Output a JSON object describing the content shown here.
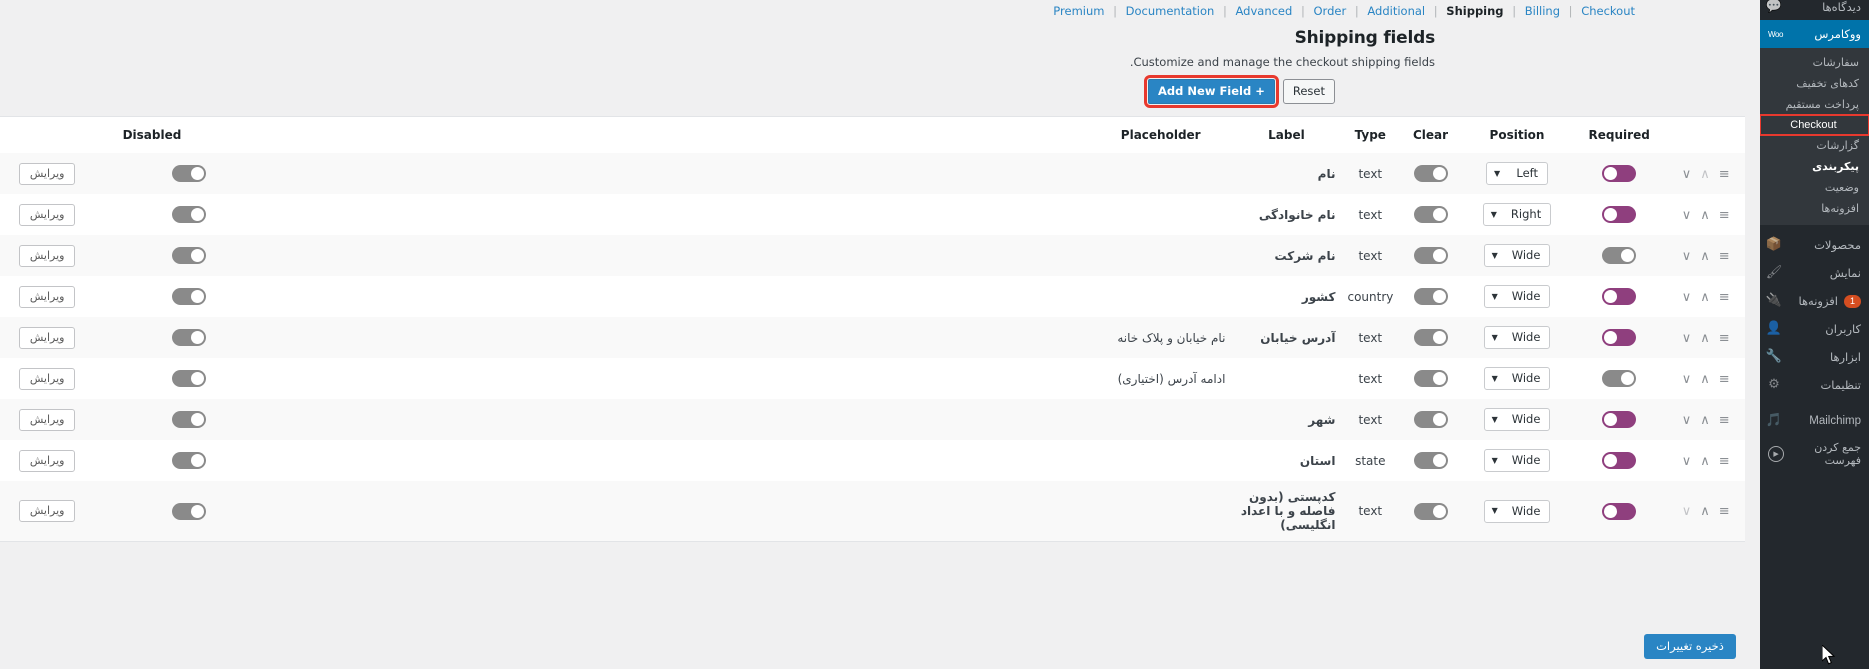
{
  "topnav": {
    "items": [
      {
        "label": "Premium",
        "active": false
      },
      {
        "label": "Documentation",
        "active": false
      },
      {
        "label": "Advanced",
        "active": false
      },
      {
        "label": "Order",
        "active": false
      },
      {
        "label": "Additional",
        "active": false
      },
      {
        "label": "Shipping",
        "active": true
      },
      {
        "label": "Billing",
        "active": false
      },
      {
        "label": "Checkout",
        "active": false
      }
    ],
    "divider": "|"
  },
  "page": {
    "title": "Shipping fields",
    "description": ".Customize and manage the checkout shipping fields",
    "reset_label": "Reset",
    "add_new_label": "Add New Field +",
    "save_label": "ذخیره تغییرات",
    "accent": "#2a85c4",
    "highlight": "#e8392e"
  },
  "table": {
    "headers": {
      "disabled": "Disabled",
      "placeholder": "Placeholder",
      "label": "Label",
      "type": "Type",
      "clear": "Clear",
      "position": "Position",
      "required": "Required"
    },
    "edit_label": "ویرایش",
    "rows": [
      {
        "edit": "ویرایش",
        "disabled": "off",
        "placeholder": "",
        "label": "نام",
        "type": "text",
        "clear": "off",
        "position": "Left",
        "required": "on",
        "sort_down": true,
        "sort_up": false
      },
      {
        "edit": "ویرایش",
        "disabled": "off",
        "placeholder": "",
        "label": "نام خانوادگی",
        "type": "text",
        "clear": "off",
        "position": "Right",
        "required": "on",
        "sort_down": true,
        "sort_up": true
      },
      {
        "edit": "ویرایش",
        "disabled": "off",
        "placeholder": "",
        "label": "نام شرکت",
        "type": "text",
        "clear": "off",
        "position": "Wide",
        "required": "off",
        "sort_down": true,
        "sort_up": true
      },
      {
        "edit": "ویرایش",
        "disabled": "off",
        "placeholder": "",
        "label": "کشور",
        "type": "country",
        "clear": "off",
        "position": "Wide",
        "required": "on",
        "sort_down": true,
        "sort_up": true
      },
      {
        "edit": "ویرایش",
        "disabled": "off",
        "placeholder": "نام خیابان و پلاک خانه",
        "label": "آدرس خیابان",
        "type": "text",
        "clear": "off",
        "position": "Wide",
        "required": "on",
        "sort_down": true,
        "sort_up": true
      },
      {
        "edit": "ویرایش",
        "disabled": "off",
        "placeholder": "ادامه آدرس (اختیاری)",
        "label": "",
        "type": "text",
        "clear": "off",
        "position": "Wide",
        "required": "off",
        "sort_down": true,
        "sort_up": true
      },
      {
        "edit": "ویرایش",
        "disabled": "off",
        "placeholder": "",
        "label": "شهر",
        "type": "text",
        "clear": "off",
        "position": "Wide",
        "required": "on",
        "sort_down": true,
        "sort_up": true
      },
      {
        "edit": "ویرایش",
        "disabled": "off",
        "placeholder": "",
        "label": "استان",
        "type": "state",
        "clear": "off",
        "position": "Wide",
        "required": "on",
        "sort_down": true,
        "sort_up": true
      },
      {
        "edit": "ویرایش",
        "disabled": "off",
        "placeholder": "",
        "label": "کدپستی (بدون فاصله و با اعداد انگلیسی)",
        "type": "text",
        "clear": "off",
        "position": "Wide",
        "required": "on",
        "sort_down": false,
        "sort_up": true
      }
    ]
  },
  "sidebar": {
    "top_partial": "دیدگاه‌ها",
    "woocommerce": {
      "label": "ووکامرس",
      "badge": "Woo",
      "submenu": [
        {
          "label": "سفارشات",
          "state": "normal"
        },
        {
          "label": "کدهای تخفیف",
          "state": "normal"
        },
        {
          "label": "پرداخت مستقیم",
          "state": "normal"
        },
        {
          "label": "Checkout",
          "state": "highlighted"
        },
        {
          "label": "گزارشات",
          "state": "normal"
        },
        {
          "label": "پیکربندی",
          "state": "current"
        },
        {
          "label": "وضعیت",
          "state": "normal"
        },
        {
          "label": "افزونه‌ها",
          "state": "normal"
        }
      ]
    },
    "items": [
      {
        "label": "محصولات",
        "icon": "products-icon",
        "badge": ""
      },
      {
        "label": "نمایش",
        "icon": "appearance-icon",
        "badge": ""
      },
      {
        "label": "افزونه‌ها",
        "icon": "plugins-icon",
        "badge": "1"
      },
      {
        "label": "کاربران",
        "icon": "users-icon",
        "badge": ""
      },
      {
        "label": "ابزارها",
        "icon": "tools-icon",
        "badge": ""
      },
      {
        "label": "تنظیمات",
        "icon": "settings-icon",
        "badge": ""
      },
      {
        "label": "Mailchimp",
        "icon": "mailchimp-icon",
        "badge": ""
      }
    ],
    "collapse": {
      "label": "جمع کردن فهرست",
      "icon": "collapse-icon"
    }
  }
}
